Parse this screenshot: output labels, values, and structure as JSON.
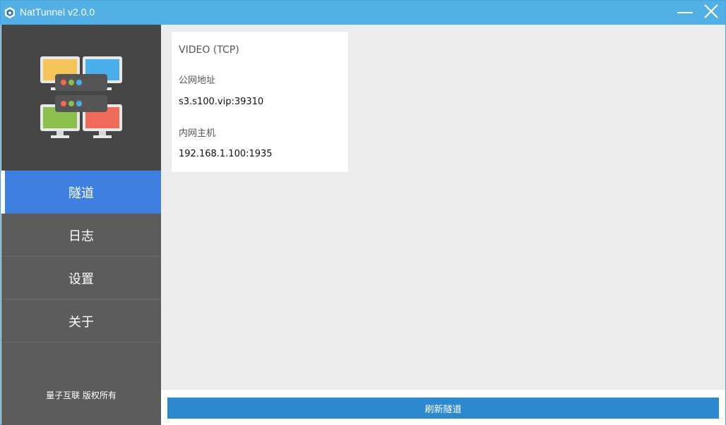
{
  "window": {
    "title": "NatTunnel v2.0.0"
  },
  "sidebar": {
    "nav_items": [
      {
        "label": "隧道",
        "active": true
      },
      {
        "label": "日志",
        "active": false
      },
      {
        "label": "设置",
        "active": false
      },
      {
        "label": "关于",
        "active": false
      }
    ],
    "copyright": "量子互联 版权所有"
  },
  "tunnel": {
    "name": "VIDEO (TCP)",
    "public_label": "公网地址",
    "public_value": "s3.s100.vip:39310",
    "private_label": "内网主机",
    "private_value": "192.168.1.100:1935"
  },
  "footer": {
    "refresh_label": "刷新隧道"
  },
  "icons": {
    "app": "cube-icon",
    "minimize": "minimize-icon",
    "close": "close-icon",
    "logo": "network-monitors-icon"
  },
  "colors": {
    "titlebar": "#52b0e4",
    "sidebar": "#5c5c5c",
    "sidebar_top": "#464646",
    "active_nav": "#3e7fe0",
    "button": "#2e88ce"
  }
}
